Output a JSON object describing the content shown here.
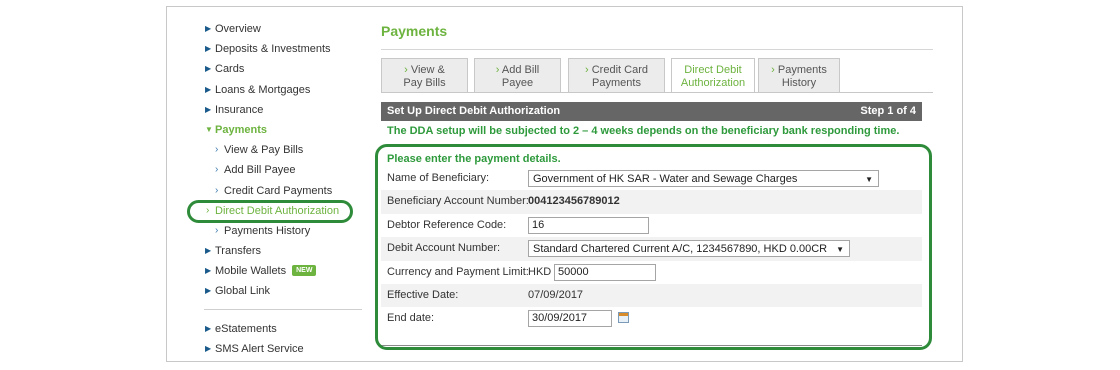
{
  "sidebar": {
    "items": [
      {
        "label": "Overview"
      },
      {
        "label": "Deposits & Investments"
      },
      {
        "label": "Cards"
      },
      {
        "label": "Loans & Mortgages"
      },
      {
        "label": "Insurance"
      },
      {
        "label": "Payments"
      },
      {
        "label": "View & Pay Bills"
      },
      {
        "label": "Add Bill Payee"
      },
      {
        "label": "Credit Card Payments"
      },
      {
        "label": "Direct Debit Authorization"
      },
      {
        "label": "Payments History"
      },
      {
        "label": "Transfers"
      },
      {
        "label": "Mobile Wallets",
        "badge": "NEW"
      },
      {
        "label": "Global Link"
      }
    ],
    "lower_items": [
      {
        "label": "eStatements"
      },
      {
        "label": "SMS Alert Service"
      }
    ]
  },
  "main": {
    "title": "Payments",
    "tabs": [
      {
        "line1": "View &",
        "line2": "Pay Bills"
      },
      {
        "line1": "Add Bill",
        "line2": "Payee"
      },
      {
        "line1": "Credit Card",
        "line2": "Payments"
      },
      {
        "line1": "Direct Debit",
        "line2": "Authorization"
      },
      {
        "line1": "Payments",
        "line2": "History"
      }
    ],
    "step_title": "Set Up Direct Debit Authorization",
    "step_indicator": "Step 1 of 4",
    "notice": "The DDA setup will be subjected to 2 – 4 weeks depends on the beneficiary bank responding time.",
    "form": {
      "heading": "Please enter the payment details.",
      "beneficiary_label": "Name of Beneficiary:",
      "beneficiary_value": "Government of HK SAR - Water and Sewage Charges",
      "account_label": "Beneficiary Account Number:",
      "account_value": "004123456789012",
      "debtor_ref_label": "Debtor Reference Code:",
      "debtor_ref_value": "16",
      "debit_account_label": "Debit Account Number:",
      "debit_account_value": "Standard Chartered Current A/C, 1234567890, HKD 0.00CR",
      "currency_label": "Currency and Payment Limit:",
      "currency_value": "HKD",
      "limit_value": "50000",
      "effective_label": "Effective Date:",
      "effective_value": "07/09/2017",
      "end_label": "End date:",
      "end_value": "30/09/2017"
    }
  },
  "colors": {
    "accent_green": "#6db33f",
    "highlight_green": "#2e8b3a",
    "header_gray": "#666666"
  },
  "icons": {
    "nav_arrow": "triangle-right-icon",
    "sub_arrow": "chevron-right-icon",
    "calendar": "calendar-icon"
  }
}
